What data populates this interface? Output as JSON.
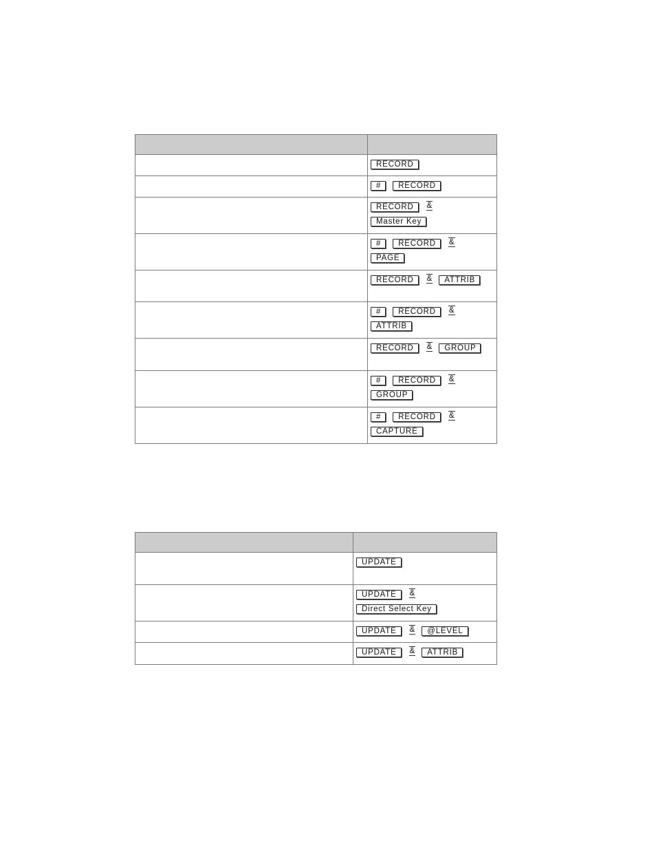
{
  "tables": [
    {
      "header": [
        "",
        ""
      ],
      "rows": [
        {
          "description": "",
          "keys": [
            [
              "RECORD"
            ]
          ]
        },
        {
          "description": "",
          "keys": [
            [
              "#",
              "RECORD"
            ]
          ]
        },
        {
          "description": "",
          "keys": [
            [
              "RECORD",
              "&"
            ],
            [
              "Master Key"
            ]
          ]
        },
        {
          "description": "",
          "keys": [
            [
              "#",
              "RECORD",
              "&"
            ],
            [
              "PAGE"
            ]
          ]
        },
        {
          "description": "",
          "keys": [
            [
              "RECORD",
              "&",
              "ATTRIB"
            ]
          ]
        },
        {
          "description": "",
          "keys": [
            [
              "#",
              "RECORD",
              "&"
            ],
            [
              "ATTRIB"
            ]
          ]
        },
        {
          "description": "",
          "keys": [
            [
              "RECORD",
              "&",
              "GROUP"
            ]
          ]
        },
        {
          "description": "",
          "keys": [
            [
              "#",
              "RECORD",
              "&"
            ],
            [
              "GROUP"
            ]
          ]
        },
        {
          "description": "",
          "keys": [
            [
              "#",
              "RECORD",
              "&"
            ],
            [
              "CAPTURE"
            ]
          ]
        }
      ]
    },
    {
      "header": [
        "",
        ""
      ],
      "rows": [
        {
          "description": "",
          "keys": [
            [
              "UPDATE"
            ]
          ]
        },
        {
          "description": "",
          "keys": [
            [
              "UPDATE",
              "&"
            ],
            [
              "Direct Select  Key"
            ]
          ]
        },
        {
          "description": "",
          "keys": [
            [
              "UPDATE",
              "&",
              "@LEVEL"
            ]
          ]
        },
        {
          "description": "",
          "keys": [
            [
              "UPDATE",
              "&",
              "ATTRIB"
            ]
          ]
        }
      ]
    }
  ],
  "colors": {
    "header_bg": "#cccccc",
    "border": "#7a7a7a",
    "key_border": "#222222"
  }
}
